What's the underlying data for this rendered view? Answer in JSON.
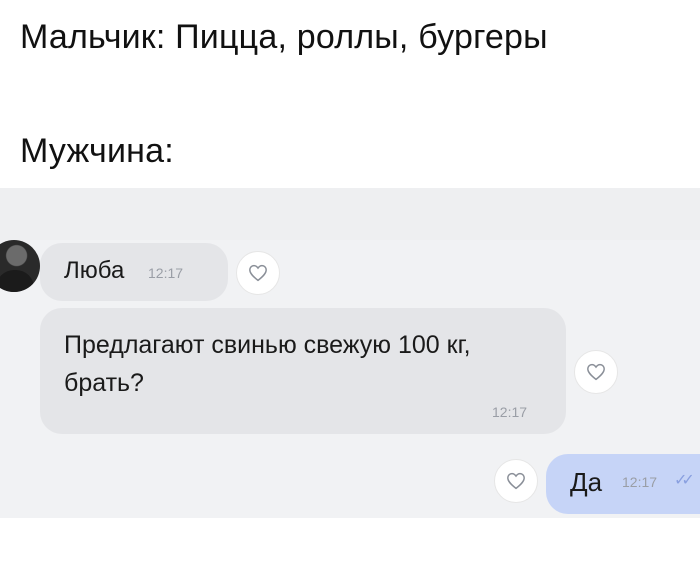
{
  "captions": {
    "line1": "Мальчик: Пицца, роллы, бургеры",
    "line2": "Мужчина:"
  },
  "chat": {
    "incoming": {
      "sender": "Люба",
      "sender_time": "12:17",
      "message": "Предлагают свинью свежую 100 кг, брать?",
      "message_time": "12:17"
    },
    "outgoing": {
      "message": "Да",
      "time": "12:17",
      "status_icon": "double-check-icon"
    },
    "icons": {
      "like": "heart-outline-icon",
      "avatar": "avatar"
    },
    "colors": {
      "incoming_bubble": "#e4e5e8",
      "outgoing_bubble": "#c6d4f7",
      "chat_background": "#f1f2f4"
    }
  }
}
